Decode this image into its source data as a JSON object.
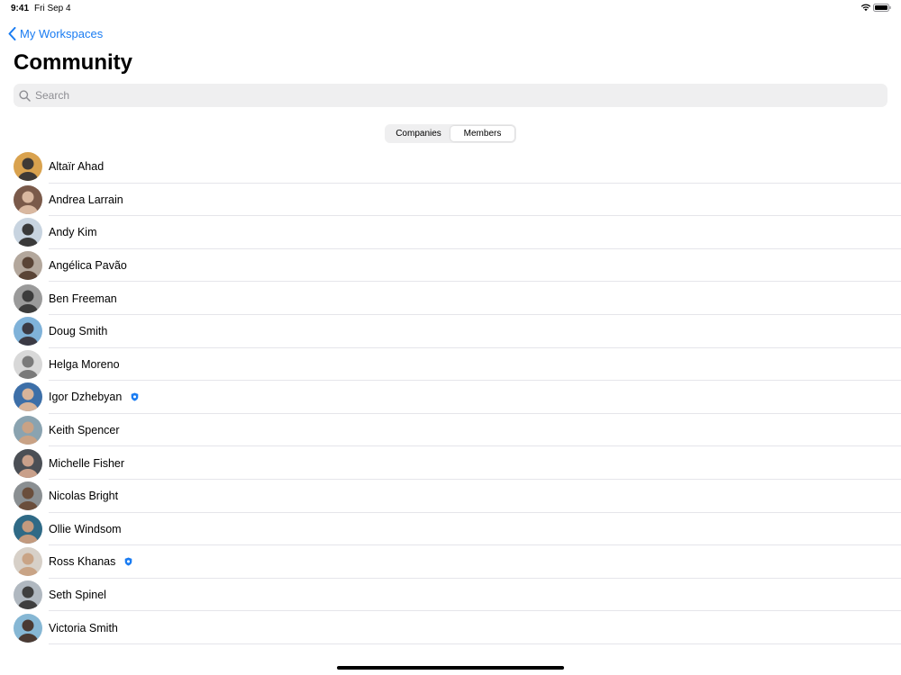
{
  "status_bar": {
    "time": "9:41",
    "date": "Fri Sep 4",
    "icons": [
      "wifi-icon",
      "battery-icon"
    ]
  },
  "nav": {
    "back_label": "My Workspaces",
    "back_icon": "chevron-left-icon",
    "accent_color": "#1a7cf2"
  },
  "page": {
    "title": "Community"
  },
  "search": {
    "placeholder": "Search",
    "value": "",
    "icon": "search-icon"
  },
  "segments": [
    {
      "label": "Companies",
      "selected": false
    },
    {
      "label": "Members",
      "selected": true
    }
  ],
  "members": [
    {
      "name": "Altaïr Ahad",
      "verified": false,
      "avatar_colors": [
        "#d9a24e",
        "#3f3a36"
      ]
    },
    {
      "name": "Andrea Larrain",
      "verified": false,
      "avatar_colors": [
        "#7a5a4a",
        "#d9b8a0"
      ]
    },
    {
      "name": "Andy Kim",
      "verified": false,
      "avatar_colors": [
        "#c8d4e0",
        "#3a3a3a"
      ]
    },
    {
      "name": "Angélica Pavão",
      "verified": false,
      "avatar_colors": [
        "#b3a79c",
        "#5a4436"
      ]
    },
    {
      "name": "Ben Freeman",
      "verified": false,
      "avatar_colors": [
        "#9a9a9a",
        "#3c3c3c"
      ]
    },
    {
      "name": "Doug Smith",
      "verified": false,
      "avatar_colors": [
        "#7fb2d9",
        "#3b3a44"
      ]
    },
    {
      "name": "Helga Moreno",
      "verified": false,
      "avatar_colors": [
        "#d8d8d8",
        "#7a7a7a"
      ]
    },
    {
      "name": "Igor Dzhebyan",
      "verified": true,
      "avatar_colors": [
        "#3d6fa8",
        "#d8b49a"
      ]
    },
    {
      "name": "Keith Spencer",
      "verified": false,
      "avatar_colors": [
        "#8aa3b0",
        "#c9a285"
      ]
    },
    {
      "name": "Michelle Fisher",
      "verified": false,
      "avatar_colors": [
        "#4b4f55",
        "#c9a08a"
      ]
    },
    {
      "name": "Nicolas Bright",
      "verified": false,
      "avatar_colors": [
        "#8a8f92",
        "#6a4e3c"
      ]
    },
    {
      "name": "Ollie Windsom",
      "verified": false,
      "avatar_colors": [
        "#2f6a86",
        "#c39a7e"
      ]
    },
    {
      "name": "Ross Khanas",
      "verified": true,
      "avatar_colors": [
        "#d7d0c8",
        "#c9a486"
      ]
    },
    {
      "name": "Seth Spinel",
      "verified": false,
      "avatar_colors": [
        "#b0b8c0",
        "#3f3f3f"
      ]
    },
    {
      "name": "Victoria Smith",
      "verified": false,
      "avatar_colors": [
        "#86b7d4",
        "#4a3a33"
      ]
    }
  ],
  "verified_color": "#1a7cf2"
}
